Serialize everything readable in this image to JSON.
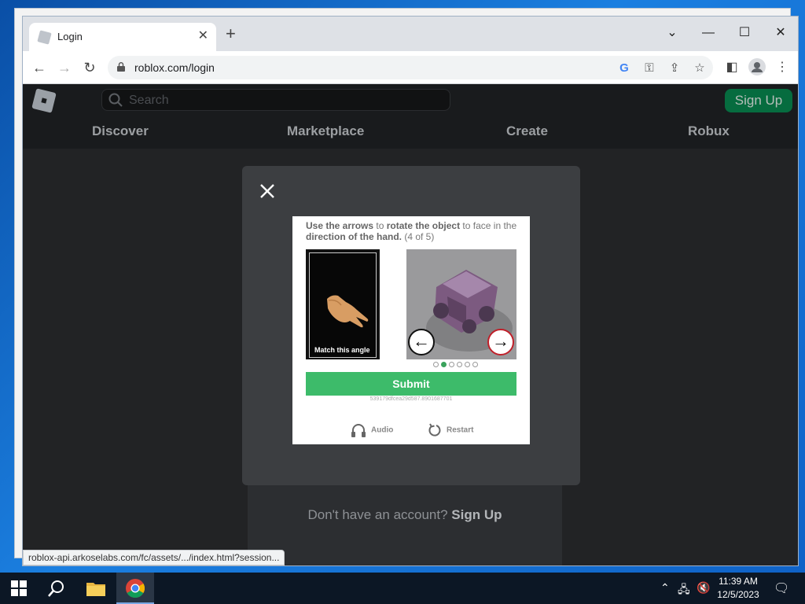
{
  "browser": {
    "tab_title": "Login",
    "url": "roblox.com/login",
    "status_url": "roblox-api.arkoselabs.com/fc/assets/.../index.html?session..."
  },
  "roblox": {
    "search_placeholder": "Search",
    "signup_label": "Sign Up",
    "nav": [
      "Discover",
      "Marketplace",
      "Create",
      "Robux"
    ],
    "no_account_text": "Don't have an account?",
    "no_account_link": "Sign Up"
  },
  "captcha": {
    "instruction_parts": [
      "Use the arrows",
      " to ",
      "rotate the object",
      " to face in the ",
      "direction of the hand.",
      " (4 of 5)"
    ],
    "reference_label": "Match this angle",
    "progress": {
      "current": 2,
      "total": 6
    },
    "submit_label": "Submit",
    "session_id": "539179dfcea29d587.8901687701",
    "audio_label": "Audio",
    "restart_label": "Restart",
    "accent_color": "#3dbb6a"
  },
  "taskbar": {
    "time": "11:39 AM",
    "date": "12/5/2023"
  }
}
